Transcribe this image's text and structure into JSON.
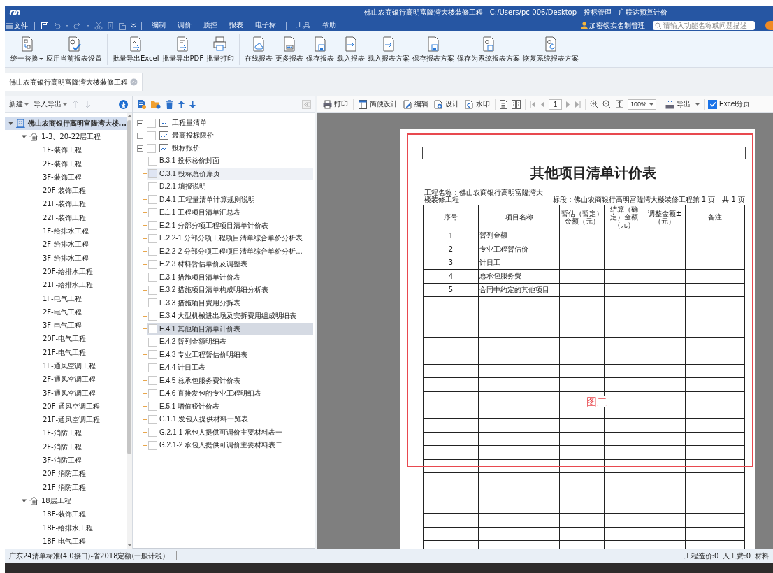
{
  "window": {
    "title": "佛山农商银行高明富隆湾大楼装修工程 - C:/Users/pc-006/Desktop - 投标管理 - 广联达预算计价"
  },
  "menu_bar": {
    "file_menu": "文件",
    "tabs": [
      {
        "label": "编制",
        "selected": false
      },
      {
        "label": "调价",
        "selected": false
      },
      {
        "label": "质控",
        "selected": false
      },
      {
        "label": "报表",
        "selected": true
      },
      {
        "label": "电子标",
        "selected": false
      }
    ],
    "menus": [
      "工具",
      "帮助"
    ],
    "account": "加密锁实名制管理",
    "search": {
      "placeholder": "请输入功能名称或问题描述"
    }
  },
  "ribbon": {
    "groups": [
      {
        "buttons": [
          {
            "kind": "replace",
            "label": "统一替换",
            "dropdown": true
          },
          {
            "kind": "apply",
            "label": "应用当前报表设置",
            "dropdown": false
          }
        ]
      },
      {
        "buttons": [
          {
            "kind": "excel",
            "label": "批量导出Excel",
            "dropdown": false
          },
          {
            "kind": "pdf",
            "label": "批量导出PDF",
            "dropdown": false
          },
          {
            "kind": "print",
            "label": "批量打印",
            "dropdown": false
          }
        ]
      },
      {
        "buttons": [
          {
            "kind": "online",
            "label": "在线报表",
            "dropdown": false
          },
          {
            "kind": "more",
            "label": "更多报表",
            "dropdown": false
          },
          {
            "kind": "save",
            "label": "保存报表",
            "dropdown": false
          },
          {
            "kind": "load",
            "label": "载入报表",
            "dropdown": false
          },
          {
            "kind": "load",
            "label": "载入报表方案",
            "dropdown": false
          },
          {
            "kind": "save",
            "label": "保存报表方案",
            "dropdown": false
          },
          {
            "kind": "savesys",
            "label": "保存为系统报表方案",
            "dropdown": false
          },
          {
            "kind": "restore",
            "label": "恢复系统报表方案",
            "dropdown": false
          }
        ]
      }
    ]
  },
  "project_tabs": [
    {
      "label": "佛山农商银行高明富隆湾大楼装修工程"
    }
  ],
  "project_tree": {
    "toolbar": {
      "new": "新建",
      "import_export": "导入导出"
    },
    "items": [
      {
        "label": "佛山农商银行高明富隆湾大楼...",
        "kind": "project",
        "selected": true,
        "expanded": true,
        "children": [
          {
            "label": "1-3、20-22层工程",
            "kind": "unit",
            "selected": false,
            "expanded": true,
            "children": [
              {
                "label": "1F-装饰工程",
                "kind": "leaf",
                "selected": false
              },
              {
                "label": "2F-装饰工程",
                "kind": "leaf",
                "selected": false
              },
              {
                "label": "3F-装饰工程",
                "kind": "leaf",
                "selected": false
              },
              {
                "label": "20F-装饰工程",
                "kind": "leaf",
                "selected": false
              },
              {
                "label": "21F-装饰工程",
                "kind": "leaf",
                "selected": false
              },
              {
                "label": "22F-装饰工程",
                "kind": "leaf",
                "selected": false
              },
              {
                "label": "1F-给排水工程",
                "kind": "leaf",
                "selected": false
              },
              {
                "label": "2F-给排水工程",
                "kind": "leaf",
                "selected": false
              },
              {
                "label": "3F-给排水工程",
                "kind": "leaf",
                "selected": false
              },
              {
                "label": "20F-给排水工程",
                "kind": "leaf",
                "selected": false
              },
              {
                "label": "21F-给排水工程",
                "kind": "leaf",
                "selected": false
              },
              {
                "label": "1F-电气工程",
                "kind": "leaf",
                "selected": false
              },
              {
                "label": "2F-电气工程",
                "kind": "leaf",
                "selected": false
              },
              {
                "label": "3F-电气工程",
                "kind": "leaf",
                "selected": false
              },
              {
                "label": "20F-电气工程",
                "kind": "leaf",
                "selected": false
              },
              {
                "label": "21F-电气工程",
                "kind": "leaf",
                "selected": false
              },
              {
                "label": "1F-通风空调工程",
                "kind": "leaf",
                "selected": false
              },
              {
                "label": "2F-通风空调工程",
                "kind": "leaf",
                "selected": false
              },
              {
                "label": "3F-通风空调工程",
                "kind": "leaf",
                "selected": false
              },
              {
                "label": "20F-通风空调工程",
                "kind": "leaf",
                "selected": false
              },
              {
                "label": "21F-通风空调工程",
                "kind": "leaf",
                "selected": false
              },
              {
                "label": "1F-消防工程",
                "kind": "leaf",
                "selected": false
              },
              {
                "label": "2F-消防工程",
                "kind": "leaf",
                "selected": false
              },
              {
                "label": "3F-消防工程",
                "kind": "leaf",
                "selected": false
              },
              {
                "label": "20F-消防工程",
                "kind": "leaf",
                "selected": false
              },
              {
                "label": "21F-消防工程",
                "kind": "leaf",
                "selected": false
              }
            ]
          },
          {
            "label": "18层工程",
            "kind": "unit",
            "selected": false,
            "expanded": true,
            "children": [
              {
                "label": "18F-装饰工程",
                "kind": "leaf",
                "selected": false
              },
              {
                "label": "18F-给排水工程",
                "kind": "leaf",
                "selected": false
              },
              {
                "label": "18F-电气工程",
                "kind": "leaf",
                "selected": false
              }
            ]
          }
        ]
      }
    ]
  },
  "report_tree": {
    "items": [
      {
        "label": "工程量清单",
        "checked": false,
        "expanded": false
      },
      {
        "label": "最高投标限价",
        "checked": false,
        "expanded": false
      },
      {
        "label": "投标报价",
        "checked": false,
        "expanded": true,
        "children": [
          {
            "label": "B.3.1 投标总价封面",
            "checked": false,
            "selected": false,
            "hovered": false
          },
          {
            "label": "C.3.1 投标总价扉页",
            "checked": false,
            "selected": false,
            "hovered": true
          },
          {
            "label": "D.2.1 填报说明",
            "checked": false,
            "selected": false,
            "hovered": false
          },
          {
            "label": "D.4.1 工程量清单计算规则说明",
            "checked": false,
            "selected": false,
            "hovered": false
          },
          {
            "label": "E.1.1 工程项目清单汇总表",
            "checked": false,
            "selected": false,
            "hovered": false
          },
          {
            "label": "E.2.1 分部分项工程项目清单计价表",
            "checked": false,
            "selected": false,
            "hovered": false
          },
          {
            "label": "E.2.2-1 分部分项工程项目清单综合单价分析表",
            "checked": false,
            "selected": false,
            "hovered": false
          },
          {
            "label": "E.2.2-2 分部分项工程项目清单综合单价分析…",
            "checked": false,
            "selected": false,
            "hovered": false
          },
          {
            "label": "E.2.3 材料暂估单价及调整表",
            "checked": false,
            "selected": false,
            "hovered": false
          },
          {
            "label": "E.3.1 措施项目清单计价表",
            "checked": false,
            "selected": false,
            "hovered": false
          },
          {
            "label": "E.3.2 措施项目清单构成明细分析表",
            "checked": false,
            "selected": false,
            "hovered": false
          },
          {
            "label": "E.3.3 措施项目费用分拆表",
            "checked": false,
            "selected": false,
            "hovered": false
          },
          {
            "label": "E.3.4 大型机械进出场及安拆费用组成明细表",
            "checked": false,
            "selected": false,
            "hovered": false
          },
          {
            "label": "E.4.1 其他项目清单计价表",
            "checked": false,
            "selected": true,
            "hovered": false
          },
          {
            "label": "E.4.2 暂列金额明细表",
            "checked": false,
            "selected": false,
            "hovered": false
          },
          {
            "label": "E.4.3 专业工程暂估价明细表",
            "checked": false,
            "selected": false,
            "hovered": false
          },
          {
            "label": "E.4.4 计日工表",
            "checked": false,
            "selected": false,
            "hovered": false
          },
          {
            "label": "E.4.5 总承包服务费计价表",
            "checked": false,
            "selected": false,
            "hovered": false
          },
          {
            "label": "E.4.6 直接发包的专业工程明细表",
            "checked": false,
            "selected": false,
            "hovered": false
          },
          {
            "label": "E.5.1 增值税计价表",
            "checked": false,
            "selected": false,
            "hovered": false
          },
          {
            "label": "G.1.1 发包人提供材料一览表",
            "checked": false,
            "selected": false,
            "hovered": false
          },
          {
            "label": "G.2.1-1 承包人提供可调价主要材料表一",
            "checked": false,
            "selected": false,
            "hovered": false
          },
          {
            "label": "G.2.1-2 承包人提供可调价主要材料表二",
            "checked": false,
            "selected": false,
            "hovered": false
          }
        ]
      }
    ]
  },
  "preview": {
    "toolbar": [
      {
        "kind": "print",
        "label": "打印"
      },
      {
        "kind": "simple-design",
        "label": "简便设计"
      },
      {
        "kind": "edit",
        "label": "编辑"
      },
      {
        "kind": "design",
        "label": "设计"
      },
      {
        "kind": "watermark",
        "label": "水印"
      }
    ],
    "page": "1",
    "zoom": "100%",
    "export": "导出",
    "excel_paging": {
      "label": "Excel分页",
      "checked": true
    },
    "report": {
      "title": "其他项目清单计价表",
      "project_name": "工程名称：佛山农商银行高明富隆湾大楼装修工程",
      "section": "标段：佛山农商银行高明富隆湾大楼装修工程",
      "page_info": "第 1 页　共 1 页",
      "columns": [
        "序号",
        "项目名称",
        "暂估（暂定）金额（元）",
        "结算（确定）金额（元）",
        "调整金额±（元）",
        "备注"
      ],
      "rows": [
        [
          "1",
          "暂列金额"
        ],
        [
          "2",
          "专业工程暂估价"
        ],
        [
          "3",
          "计日工"
        ],
        [
          "4",
          "总承包服务费"
        ],
        [
          "5",
          "合同中约定的其他项目"
        ]
      ]
    },
    "annotation": {
      "label": "图二"
    }
  },
  "status_bar": {
    "left": "广东24清单标准(4.0接口)-省2018定额(一般计税)",
    "right": [
      "工程造价:0",
      "人工费:0",
      "材料"
    ]
  }
}
